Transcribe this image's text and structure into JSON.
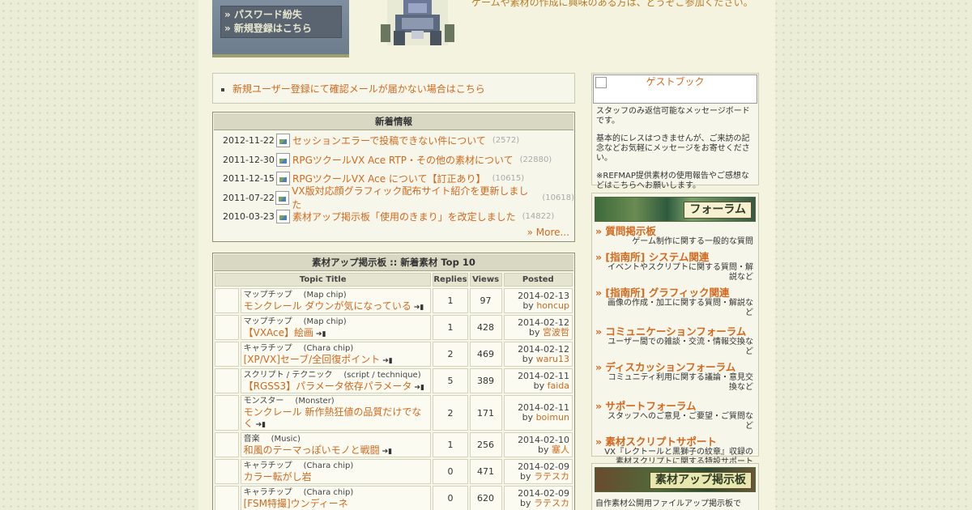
{
  "header": {
    "login_links": [
      "» パスワード紛失",
      "» 新規登録はこちら"
    ],
    "intro_text": "ゲームや素材の作成に興味のある方は、どうぞご参加ください。"
  },
  "notice": {
    "text": "新規ユーザー登録にて確認メールが届かない場合はこちら"
  },
  "news": {
    "title": "新着情報",
    "items": [
      {
        "date": "2012-11-22",
        "title": "セッションエラーで投稿できない件について",
        "count": "(2572)"
      },
      {
        "date": "2011-12-30",
        "title": "RPGツクールVX Ace RTP・その他の素材について",
        "count": "(22880)"
      },
      {
        "date": "2011-12-15",
        "title": "RPGツクールVX Ace について【訂正あり】",
        "count": "(10615)"
      },
      {
        "date": "2011-07-22",
        "title": "VX版対応顔グラフィック配布サイト紹介を更新しました",
        "count": "(10618)"
      },
      {
        "date": "2010-03-23",
        "title": "素材アップ掲示板「使用のきまり」を改定しました",
        "count": "(14822)"
      }
    ],
    "more": "» More..."
  },
  "topics": {
    "title": "素材アップ掲示板 :: 新着素材 Top 10",
    "headers": {
      "topic": "Topic Title",
      "replies": "Replies",
      "views": "Views",
      "posted": "Posted"
    },
    "rows": [
      {
        "cat": "マップチップ",
        "cat_en": "(Map chip)",
        "title": "モンクレール ダウンが気になっている",
        "replies": "1",
        "views": "97",
        "date": "2014-02-13",
        "by": "by",
        "user": "honcup"
      },
      {
        "cat": "マップチップ",
        "cat_en": "(Map chip)",
        "title": "【VXAce】絵画",
        "replies": "1",
        "views": "428",
        "date": "2014-02-12",
        "by": "by",
        "user": "宮波哲"
      },
      {
        "cat": "キャラチップ",
        "cat_en": "(Chara chip)",
        "title": "[XP/VX]セーブ/全回復ポイント",
        "replies": "2",
        "views": "469",
        "date": "2014-02-12",
        "by": "by",
        "user": "waru13"
      },
      {
        "cat": "スクリプト / テクニック",
        "cat_en": "(script / technique)",
        "title": "【RGSS3】パラメータ依存パラメータ",
        "replies": "5",
        "views": "389",
        "date": "2014-02-11",
        "by": "by",
        "user": "faida"
      },
      {
        "cat": "モンスター",
        "cat_en": "(Monster)",
        "title": "モンクレール 新作熱狂値の品質だけでなく",
        "replies": "2",
        "views": "171",
        "date": "2014-02-11",
        "by": "by",
        "user": "boimun"
      },
      {
        "cat": "音楽",
        "cat_en": "(Music)",
        "title": "和風のテーマっぽいモノと戦闘",
        "replies": "1",
        "views": "256",
        "date": "2014-02-10",
        "by": "by",
        "user": "塞人"
      },
      {
        "cat": "キャラチップ",
        "cat_en": "(Chara chip)",
        "title": "カラー転がし岩",
        "replies": "0",
        "views": "471",
        "date": "2014-02-09",
        "by": "by",
        "user": "ラテスカ"
      },
      {
        "cat": "キャラチップ",
        "cat_en": "(Chara chip)",
        "title": "[FSM特撮]ウンディーネ",
        "replies": "0",
        "views": "620",
        "date": "2014-02-09",
        "by": "by",
        "user": "ラテスカ"
      }
    ]
  },
  "guestbook": {
    "image_alt": "ゲストブック",
    "paragraphs": [
      "スタッフのみ返信可能なメッセージボードです。",
      "基本的にレスはつきませんが、ご来訪の記念などお気軽にメッセージをお寄せください。",
      "※REFMAP提供素材の使用報告やご感想などはこちらへお願いします。"
    ]
  },
  "forum": {
    "banner": "フォーラム",
    "items": [
      {
        "title": "» 質問掲示板",
        "desc": "ゲーム制作に関する一般的な質問"
      },
      {
        "title": "» [指南所] システム関連",
        "desc": "イベントやスクリプトに関する質問・解説など"
      },
      {
        "title": "» [指南所] グラフィック関連",
        "desc": "画像の作成・加工に関する質問・解説など"
      },
      {
        "title": "» コミュニケーションフォーラム",
        "desc": "ユーザー間での雑談・交流・情報交換など"
      },
      {
        "title": "» ディスカッションフォーラム",
        "desc": "コミュニティ利用に関する議論・意見交換など"
      },
      {
        "title": "» サポートフォーラム",
        "desc": "スタッフへのご意見・ご要望・ご質問など"
      },
      {
        "title": "» 素材スクリプトサポート",
        "desc": "VX『レクトールと黒獅子の紋章』収録の素材スクリプトに関する特設サポート"
      }
    ]
  },
  "upload": {
    "banner": "素材アップ掲示板",
    "text": "自作素材公開用ファイルアップ掲示板です。"
  }
}
